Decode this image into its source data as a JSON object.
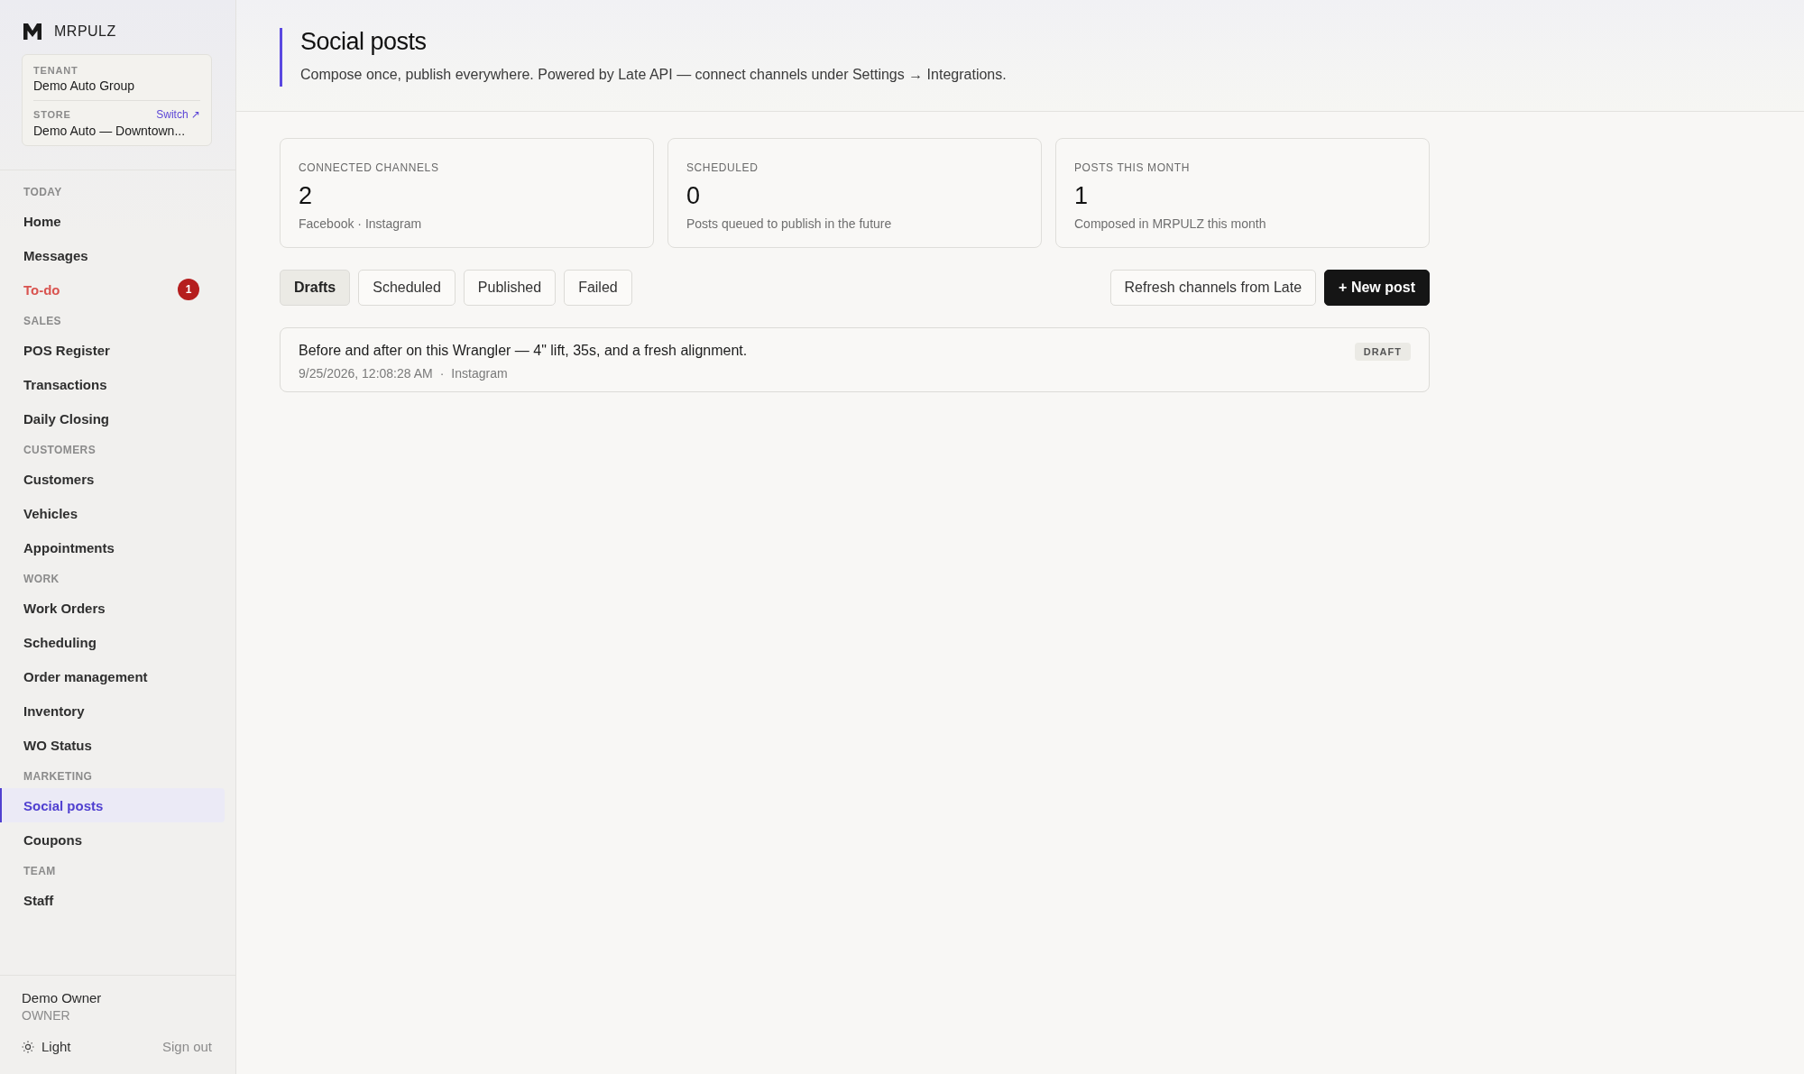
{
  "brand": {
    "name": "MRPULZ"
  },
  "context": {
    "tenant_label": "TENANT",
    "tenant": "Demo Auto Group",
    "store_label": "STORE",
    "switch_link": "Switch ↗",
    "store": "Demo Auto — Downtown..."
  },
  "sidebar": {
    "sections": [
      {
        "title": "TODAY",
        "items": [
          {
            "label": "Home",
            "selected": false,
            "urgent": false
          },
          {
            "label": "Messages",
            "selected": false,
            "urgent": false
          },
          {
            "label": "To-do",
            "selected": false,
            "urgent": true,
            "badge": "1"
          }
        ]
      },
      {
        "title": "SALES",
        "items": [
          {
            "label": "POS Register",
            "selected": false,
            "urgent": false
          },
          {
            "label": "Transactions",
            "selected": false,
            "urgent": false
          },
          {
            "label": "Daily Closing",
            "selected": false,
            "urgent": false
          }
        ]
      },
      {
        "title": "CUSTOMERS",
        "items": [
          {
            "label": "Customers",
            "selected": false,
            "urgent": false
          },
          {
            "label": "Vehicles",
            "selected": false,
            "urgent": false
          },
          {
            "label": "Appointments",
            "selected": false,
            "urgent": false
          }
        ]
      },
      {
        "title": "WORK",
        "items": [
          {
            "label": "Work Orders",
            "selected": false,
            "urgent": false
          },
          {
            "label": "Scheduling",
            "selected": false,
            "urgent": false
          },
          {
            "label": "Order management",
            "selected": false,
            "urgent": false
          },
          {
            "label": "Inventory",
            "selected": false,
            "urgent": false
          },
          {
            "label": "WO Status",
            "selected": false,
            "urgent": false
          }
        ]
      },
      {
        "title": "MARKETING",
        "items": [
          {
            "label": "Social posts",
            "selected": true,
            "urgent": false
          },
          {
            "label": "Coupons",
            "selected": false,
            "urgent": false
          }
        ]
      },
      {
        "title": "TEAM",
        "items": [
          {
            "label": "Staff",
            "selected": false,
            "urgent": false
          }
        ]
      }
    ]
  },
  "user": {
    "name": "Demo Owner",
    "role": "OWNER",
    "theme": "Light",
    "sign_out": "Sign out"
  },
  "header": {
    "title": "Social posts",
    "subtitle": "Compose once, publish everywhere. Powered by Late API — connect channels under Settings → Integrations."
  },
  "stats": [
    {
      "label": "CONNECTED CHANNELS",
      "value": "2",
      "note": "Facebook · Instagram"
    },
    {
      "label": "SCHEDULED",
      "value": "0",
      "note": "Posts queued to publish in the future"
    },
    {
      "label": "POSTS THIS MONTH",
      "value": "1",
      "note": "Composed in MRPULZ this month"
    }
  ],
  "tabs": [
    {
      "label": "Drafts",
      "selected": true
    },
    {
      "label": "Scheduled",
      "selected": false
    },
    {
      "label": "Published",
      "selected": false
    },
    {
      "label": "Failed",
      "selected": false
    }
  ],
  "actions": [
    {
      "label": "Refresh channels from Late",
      "kind": "secondary"
    },
    {
      "label": "+ New post",
      "kind": "primary"
    }
  ],
  "posts": [
    {
      "text": "Before and after on this Wrangler — 4\" lift, 35s, and a fresh alignment.",
      "date": "9/25/2026, 12:08:28 AM",
      "separator": "·",
      "channel": "Instagram",
      "status": "DRAFT"
    }
  ]
}
